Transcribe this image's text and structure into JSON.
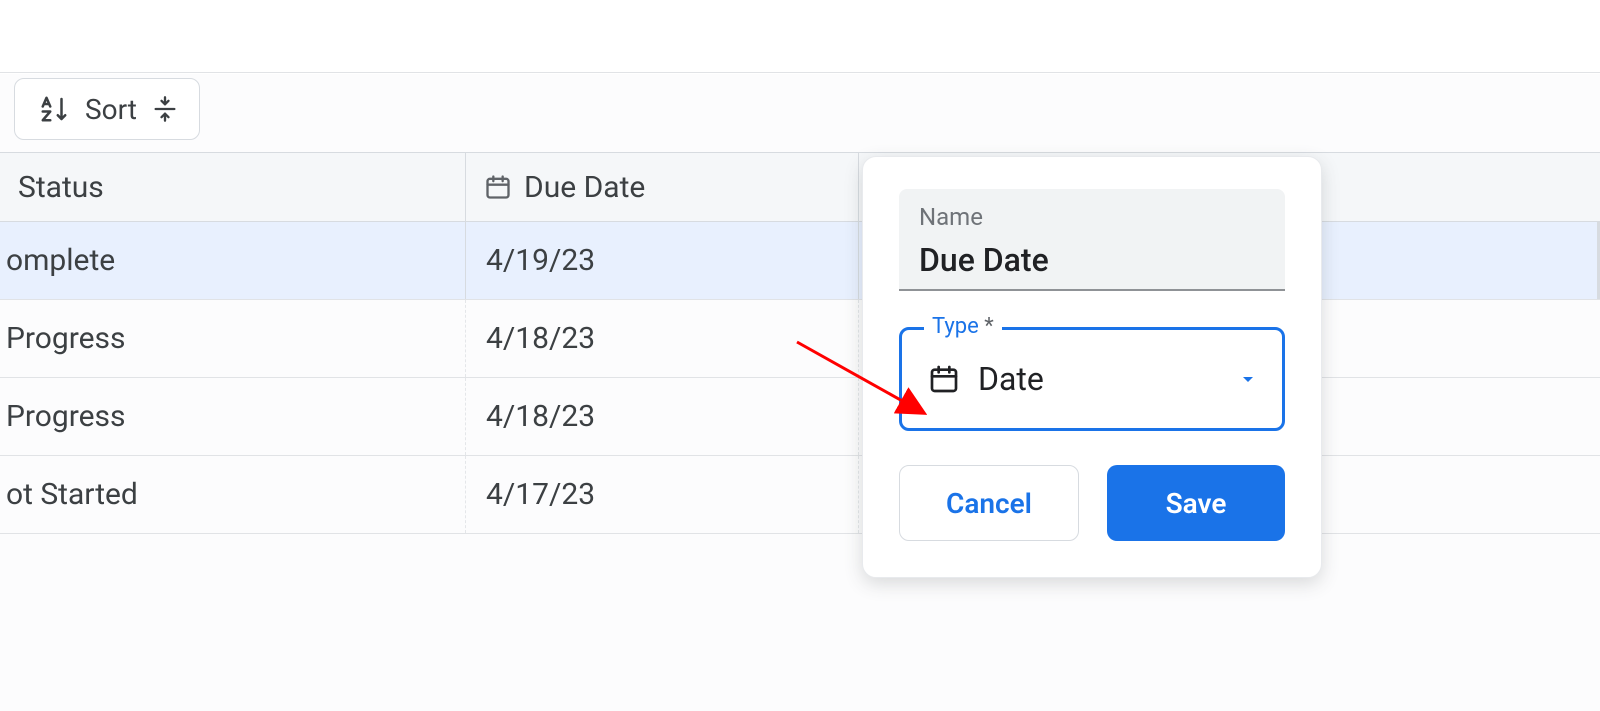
{
  "toolbar": {
    "sort_label": "Sort"
  },
  "columns": {
    "status": "Status",
    "due_date": "Due Date"
  },
  "rows": [
    {
      "status": "omplete",
      "due": "4/19/23",
      "selected": true
    },
    {
      "status": "Progress",
      "due": "4/18/23",
      "selected": false
    },
    {
      "status": "Progress",
      "due": "4/18/23",
      "selected": false
    },
    {
      "status": "ot Started",
      "due": "4/17/23",
      "selected": false
    }
  ],
  "popover": {
    "name_label": "Name",
    "name_value": "Due Date",
    "type_label": "Type",
    "type_required_mark": "*",
    "type_value": "Date",
    "cancel": "Cancel",
    "save": "Save"
  },
  "colors": {
    "accent": "#1a73e8",
    "annotation": "#ff0000"
  }
}
